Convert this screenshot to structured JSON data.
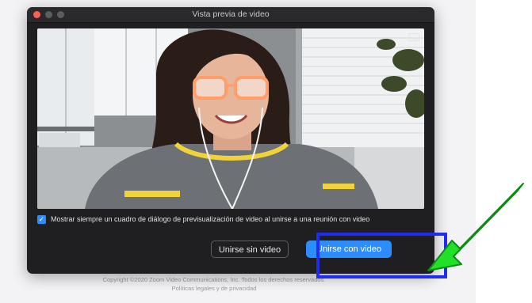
{
  "window": {
    "title": "Vista previa de video"
  },
  "preview": {
    "always_show_label": "Mostrar siempre un cuadro de diálogo de previsualización de video al unirse a una reunión con video",
    "always_show_checked": true
  },
  "buttons": {
    "join_without_video": "Unirse sin video",
    "join_with_video": "Unirse con video"
  },
  "footer": {
    "copyright": "Copyright ©2020 Zoom Video Communications, Inc. Todos los derechos reservados.",
    "legal": "Políticas legales y de privacidad"
  },
  "colors": {
    "accent": "#2d8cff",
    "highlight_box": "#1f2df0",
    "arrow": "#22e02a",
    "window_bg": "#1f1f21"
  },
  "icons": {
    "close": "red-close-dot",
    "check": "check-icon",
    "pip": "picture-in-picture-icon",
    "arrow": "green-arrow-icon"
  }
}
